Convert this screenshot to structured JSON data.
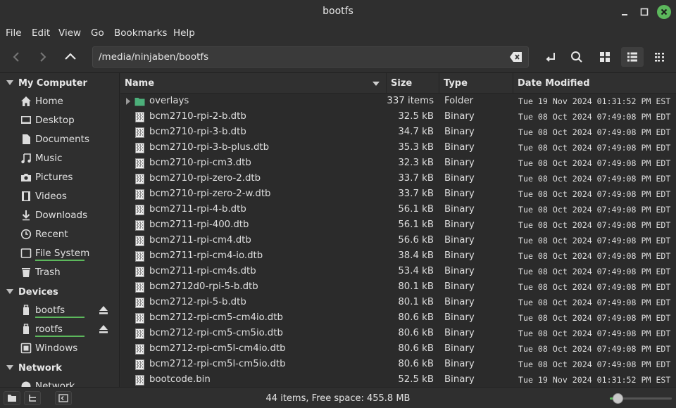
{
  "window": {
    "title": "bootfs"
  },
  "menu": [
    "File",
    "Edit",
    "View",
    "Go",
    "Bookmarks",
    "Help"
  ],
  "toolbar": {
    "path": "/media/ninjaben/bootfs"
  },
  "sidebar": {
    "sections": [
      {
        "title": "My Computer",
        "items": [
          "Home",
          "Desktop",
          "Documents",
          "Music",
          "Pictures",
          "Videos",
          "Downloads",
          "Recent",
          "File System",
          "Trash"
        ]
      },
      {
        "title": "Devices",
        "items": [
          "bootfs",
          "rootfs",
          "Windows"
        ]
      },
      {
        "title": "Network",
        "items": [
          "Network"
        ]
      }
    ]
  },
  "columns": {
    "name": "Name",
    "size": "Size",
    "type": "Type",
    "date": "Date Modified"
  },
  "files": [
    {
      "name": "overlays",
      "size": "337 items",
      "type": "Folder",
      "date": "Tue 19 Nov 2024 01:31:52 PM EST",
      "folder": true
    },
    {
      "name": "bcm2710-rpi-2-b.dtb",
      "size": "32.5 kB",
      "type": "Binary",
      "date": "Tue 08 Oct 2024 07:49:08 PM EDT"
    },
    {
      "name": "bcm2710-rpi-3-b.dtb",
      "size": "34.7 kB",
      "type": "Binary",
      "date": "Tue 08 Oct 2024 07:49:08 PM EDT"
    },
    {
      "name": "bcm2710-rpi-3-b-plus.dtb",
      "size": "35.3 kB",
      "type": "Binary",
      "date": "Tue 08 Oct 2024 07:49:08 PM EDT"
    },
    {
      "name": "bcm2710-rpi-cm3.dtb",
      "size": "32.3 kB",
      "type": "Binary",
      "date": "Tue 08 Oct 2024 07:49:08 PM EDT"
    },
    {
      "name": "bcm2710-rpi-zero-2.dtb",
      "size": "33.7 kB",
      "type": "Binary",
      "date": "Tue 08 Oct 2024 07:49:08 PM EDT"
    },
    {
      "name": "bcm2710-rpi-zero-2-w.dtb",
      "size": "33.7 kB",
      "type": "Binary",
      "date": "Tue 08 Oct 2024 07:49:08 PM EDT"
    },
    {
      "name": "bcm2711-rpi-4-b.dtb",
      "size": "56.1 kB",
      "type": "Binary",
      "date": "Tue 08 Oct 2024 07:49:08 PM EDT"
    },
    {
      "name": "bcm2711-rpi-400.dtb",
      "size": "56.1 kB",
      "type": "Binary",
      "date": "Tue 08 Oct 2024 07:49:08 PM EDT"
    },
    {
      "name": "bcm2711-rpi-cm4.dtb",
      "size": "56.6 kB",
      "type": "Binary",
      "date": "Tue 08 Oct 2024 07:49:08 PM EDT"
    },
    {
      "name": "bcm2711-rpi-cm4-io.dtb",
      "size": "38.4 kB",
      "type": "Binary",
      "date": "Tue 08 Oct 2024 07:49:08 PM EDT"
    },
    {
      "name": "bcm2711-rpi-cm4s.dtb",
      "size": "53.4 kB",
      "type": "Binary",
      "date": "Tue 08 Oct 2024 07:49:08 PM EDT"
    },
    {
      "name": "bcm2712d0-rpi-5-b.dtb",
      "size": "80.1 kB",
      "type": "Binary",
      "date": "Tue 08 Oct 2024 07:49:08 PM EDT"
    },
    {
      "name": "bcm2712-rpi-5-b.dtb",
      "size": "80.1 kB",
      "type": "Binary",
      "date": "Tue 08 Oct 2024 07:49:08 PM EDT"
    },
    {
      "name": "bcm2712-rpi-cm5-cm4io.dtb",
      "size": "80.6 kB",
      "type": "Binary",
      "date": "Tue 08 Oct 2024 07:49:08 PM EDT"
    },
    {
      "name": "bcm2712-rpi-cm5-cm5io.dtb",
      "size": "80.6 kB",
      "type": "Binary",
      "date": "Tue 08 Oct 2024 07:49:08 PM EDT"
    },
    {
      "name": "bcm2712-rpi-cm5l-cm4io.dtb",
      "size": "80.6 kB",
      "type": "Binary",
      "date": "Tue 08 Oct 2024 07:49:08 PM EDT"
    },
    {
      "name": "bcm2712-rpi-cm5l-cm5io.dtb",
      "size": "80.6 kB",
      "type": "Binary",
      "date": "Tue 08 Oct 2024 07:49:08 PM EDT"
    },
    {
      "name": "bootcode.bin",
      "size": "52.5 kB",
      "type": "Binary",
      "date": "Tue 19 Nov 2024 01:31:52 PM EST"
    }
  ],
  "status": {
    "text": "44 items, Free space: 455.8 MB",
    "zoom_fraction": 0.12
  },
  "colors": {
    "accent": "#5cb85c",
    "folder": "#4caf7a"
  }
}
